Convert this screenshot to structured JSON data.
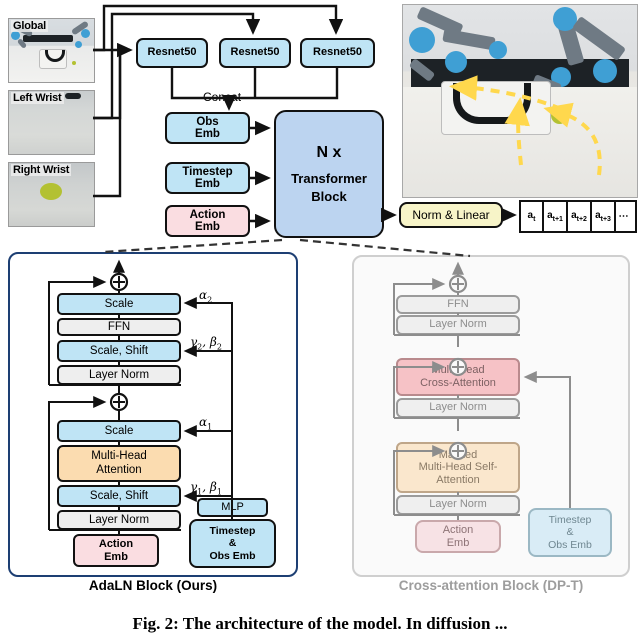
{
  "figure": {
    "caption": "Fig. 2:  The architecture of the model.  In diffusion ...",
    "panel_left_caption": "AdaLN Block (Ours)",
    "panel_right_caption": "Cross-attention Block (DP-T)"
  },
  "colors": {
    "blue_box": "#bfe4f5",
    "pink_box": "#fadde1",
    "orange_box": "#fbdcb0",
    "grey_box": "#eeeeee",
    "yellow_box": "#f7f4c8",
    "transformer_blue": "#bcd4f0",
    "panel_left_border": "#1d3f73",
    "panel_right_border": "#cfcfcf",
    "cross_attn_pink": "#f6c2c6",
    "masked_attn_cream": "#fae7cd",
    "dashed_connector": "#333333",
    "trajectory_yellow": "#ffd84d"
  },
  "cameras": [
    {
      "label": "Global",
      "name": "global-camera-view"
    },
    {
      "label": "Left Wrist",
      "name": "left-wrist-camera-view"
    },
    {
      "label": "Right Wrist",
      "name": "right-wrist-camera-view"
    }
  ],
  "encoders": {
    "label": "Resnet50",
    "items": [
      "Resnet50",
      "Resnet50",
      "Resnet50"
    ],
    "concat_label": "Concat"
  },
  "embeddings": {
    "obs": "Obs\nEmb",
    "obs_l1": "Obs",
    "obs_l2": "Emb",
    "timestep_l1": "Timestep",
    "timestep_l2": "Emb",
    "action_l1": "Action",
    "action_l2": "Emb"
  },
  "transformer": {
    "nx": "N x",
    "line1": "Transformer",
    "line2": "Block"
  },
  "head": {
    "norm_linear": "Norm & Linear"
  },
  "action_tokens": {
    "items": [
      "a_t",
      "a_t+1",
      "a_t+2",
      "a_t+3",
      "⋯"
    ],
    "base": "a",
    "subs": [
      "t",
      "t+1",
      "t+2",
      "t+3"
    ],
    "ellipsis": "⋯"
  },
  "adaln_block": {
    "title": "AdaLN Block (Ours)",
    "upper": {
      "scale": "Scale",
      "ffn": "FFN",
      "scale_shift": "Scale, Shift",
      "layer_norm": "Layer Norm",
      "alpha": "α",
      "alpha_sub": "2",
      "gamma_beta": "γ, β",
      "gamma_beta_sub": "2"
    },
    "lower": {
      "scale": "Scale",
      "attention_l1": "Multi-Head",
      "attention_l2": "Attention",
      "scale_shift": "Scale, Shift",
      "layer_norm": "Layer Norm",
      "alpha": "α",
      "alpha_sub": "1",
      "gamma_beta": "γ, β",
      "gamma_beta_sub": "1"
    },
    "action_emb_l1": "Action",
    "action_emb_l2": "Emb",
    "mlp": "MLP",
    "cond_l1": "Timestep",
    "cond_l2": "&",
    "cond_l3": "Obs Emb",
    "plus": "+"
  },
  "crossattn_block": {
    "title": "Cross-attention Block (DP-T)",
    "ffn": "FFN",
    "layer_norm": "Layer Norm",
    "cross_attention_l1": "Multi-Head",
    "cross_attention_l2": "Cross-Attention",
    "masked_l1": "Masked",
    "masked_l2": "Multi-Head Self-",
    "masked_l3": "Attention",
    "action_emb_l1": "Action",
    "action_emb_l2": "Emb",
    "cond_l1": "Timestep",
    "cond_l2": "&",
    "cond_l3": "Obs Emb",
    "plus": "+"
  }
}
